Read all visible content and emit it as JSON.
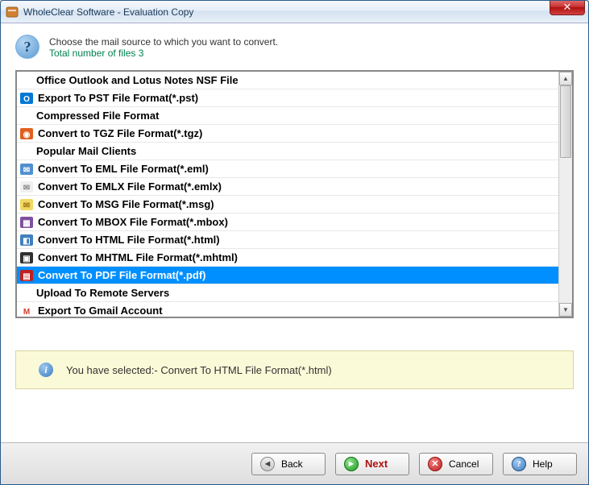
{
  "window": {
    "title": "WholeClear Software - Evaluation Copy"
  },
  "header": {
    "line1": "Choose the mail source to which you want to convert.",
    "line2": "Total number of files 3"
  },
  "list": {
    "selected_index": 8,
    "items": [
      {
        "type": "header",
        "label": "Office Outlook and Lotus Notes NSF File"
      },
      {
        "type": "option",
        "icon": "outlook-icon",
        "label": "Export To PST File Format(*.pst)"
      },
      {
        "type": "header",
        "label": "Compressed File Format"
      },
      {
        "type": "option",
        "icon": "tgz-icon",
        "label": "Convert to TGZ File Format(*.tgz)"
      },
      {
        "type": "header",
        "label": "Popular Mail Clients"
      },
      {
        "type": "option",
        "icon": "eml-icon",
        "label": "Convert To EML File Format(*.eml)"
      },
      {
        "type": "option",
        "icon": "emlx-icon",
        "label": "Convert To EMLX File Format(*.emlx)"
      },
      {
        "type": "option",
        "icon": "msg-icon",
        "label": "Convert To MSG File Format(*.msg)"
      },
      {
        "type": "option",
        "icon": "mbox-icon",
        "label": "Convert To MBOX File Format(*.mbox)"
      },
      {
        "type": "option",
        "icon": "html-icon",
        "label": "Convert To HTML File Format(*.html)"
      },
      {
        "type": "option",
        "icon": "mhtml-icon",
        "label": "Convert To MHTML File Format(*.mhtml)"
      },
      {
        "type": "option",
        "icon": "pdf-icon",
        "label": "Convert To PDF File Format(*.pdf)"
      },
      {
        "type": "header",
        "label": "Upload To Remote Servers"
      },
      {
        "type": "option",
        "icon": "gmail-icon",
        "label": "Export To Gmail Account"
      }
    ]
  },
  "info": {
    "text": "You have selected:- Convert To HTML File Format(*.html)"
  },
  "footer": {
    "back": "Back",
    "next": "Next",
    "cancel": "Cancel",
    "help": "Help"
  },
  "icons": {
    "outlook-icon": {
      "bg": "#0078d4",
      "fg": "#fff",
      "glyph": "O"
    },
    "tgz-icon": {
      "bg": "#e06020",
      "fg": "#fff",
      "glyph": "◉"
    },
    "eml-icon": {
      "bg": "#5090d0",
      "fg": "#fff",
      "glyph": "✉"
    },
    "emlx-icon": {
      "bg": "#f0f0f0",
      "fg": "#888",
      "glyph": "✉"
    },
    "msg-icon": {
      "bg": "#f0d860",
      "fg": "#a07010",
      "glyph": "✉"
    },
    "mbox-icon": {
      "bg": "#8050a0",
      "fg": "#fff",
      "glyph": "▦"
    },
    "html-icon": {
      "bg": "#4080c0",
      "fg": "#fff",
      "glyph": "◧"
    },
    "mhtml-icon": {
      "bg": "#303030",
      "fg": "#fff",
      "glyph": "▣"
    },
    "pdf-icon": {
      "bg": "#c02020",
      "fg": "#fff",
      "glyph": "▤"
    },
    "gmail-icon": {
      "bg": "#ffffff",
      "fg": "#d04030",
      "glyph": "M"
    }
  }
}
